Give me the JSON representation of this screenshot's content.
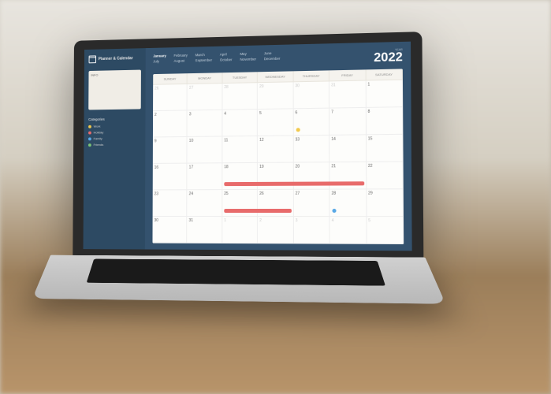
{
  "app": {
    "title": "Planner & Calendar"
  },
  "sidebar": {
    "info_label": "INFO",
    "categories_title": "Categories",
    "categories": [
      {
        "label": "Work",
        "color": "#f2c94c"
      },
      {
        "label": "Holiday",
        "color": "#e86b6b"
      },
      {
        "label": "Family",
        "color": "#5aa9e6"
      },
      {
        "label": "Friends",
        "color": "#7cc576"
      }
    ]
  },
  "header": {
    "year_label": "YEAR",
    "year": "2022",
    "months": [
      "January",
      "February",
      "March",
      "April",
      "May",
      "June",
      "July",
      "August",
      "September",
      "October",
      "November",
      "December"
    ],
    "active_month": "January"
  },
  "calendar": {
    "day_headers": [
      "SUNDAY",
      "MONDAY",
      "TUESDAY",
      "WEDNESDAY",
      "THURSDAY",
      "FRIDAY",
      "SATURDAY"
    ],
    "weeks": [
      [
        {
          "n": "26",
          "faded": true
        },
        {
          "n": "27",
          "faded": true
        },
        {
          "n": "28",
          "faded": true
        },
        {
          "n": "29",
          "faded": true
        },
        {
          "n": "30",
          "faded": true
        },
        {
          "n": "31",
          "faded": true
        },
        {
          "n": "1"
        }
      ],
      [
        {
          "n": "2"
        },
        {
          "n": "3"
        },
        {
          "n": "4"
        },
        {
          "n": "5"
        },
        {
          "n": "6",
          "dot": "#f2c94c"
        },
        {
          "n": "7"
        },
        {
          "n": "8"
        }
      ],
      [
        {
          "n": "9"
        },
        {
          "n": "10"
        },
        {
          "n": "11"
        },
        {
          "n": "12"
        },
        {
          "n": "13"
        },
        {
          "n": "14"
        },
        {
          "n": "15"
        }
      ],
      [
        {
          "n": "16"
        },
        {
          "n": "17"
        },
        {
          "n": "18",
          "bar": "#e86b6b",
          "barspan": "start"
        },
        {
          "n": "19",
          "bar": "#e86b6b",
          "barspan": "mid"
        },
        {
          "n": "20",
          "bar": "#e86b6b",
          "barspan": "mid"
        },
        {
          "n": "21",
          "bar": "#e86b6b",
          "barspan": "end"
        },
        {
          "n": "22"
        }
      ],
      [
        {
          "n": "23"
        },
        {
          "n": "24"
        },
        {
          "n": "25",
          "bar": "#e86b6b",
          "barspan": "start"
        },
        {
          "n": "26",
          "bar": "#e86b6b",
          "barspan": "end"
        },
        {
          "n": "27"
        },
        {
          "n": "28",
          "dot": "#5aa9e6"
        },
        {
          "n": "29"
        }
      ],
      [
        {
          "n": "30"
        },
        {
          "n": "31"
        },
        {
          "n": "1",
          "faded": true
        },
        {
          "n": "2",
          "faded": true
        },
        {
          "n": "3",
          "faded": true
        },
        {
          "n": "4",
          "faded": true
        },
        {
          "n": "5",
          "faded": true
        }
      ]
    ]
  }
}
